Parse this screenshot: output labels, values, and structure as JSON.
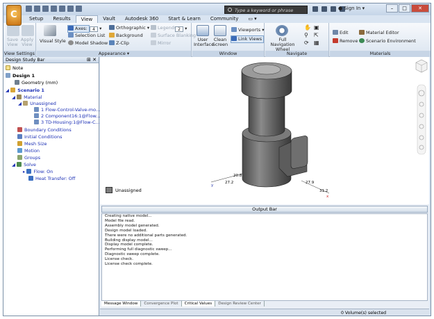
{
  "titlebar": {
    "search_placeholder": "Type a keyword or phrase",
    "signin": "Sign In"
  },
  "tabs": [
    "Setup",
    "Results",
    "View",
    "Vault",
    "Autodesk 360",
    "Start & Learn",
    "Community"
  ],
  "active_tab": "View",
  "ribbon": {
    "view_settings": {
      "save_view": "Save View",
      "apply_view": "Apply View",
      "label": "View Settings"
    },
    "appearance": {
      "visual_style": "Visual Style",
      "axes": "Axes:",
      "axes_value": "4",
      "selection_list": "Selection List",
      "model_shadow": "Model Shadow",
      "orthographic": "Orthographic",
      "background": "Background",
      "z_clip": "Z-Clip",
      "legends": "Legends:",
      "legends_value": "2",
      "surface_blanking": "Surface Blanking",
      "mirror": "Mirror",
      "label": "Appearance"
    },
    "window": {
      "user_interface": "User Interface",
      "clean_screen": "Clean Screen",
      "viewports": "Viewports",
      "link_views": "Link Views",
      "label": "Window"
    },
    "navigate": {
      "full_navigation_wheel": "Full Navigation Wheel",
      "label": "Navigate"
    },
    "materials": {
      "edit": "Edit",
      "remove": "Remove",
      "material_editor": "Material Editor",
      "scenario_environment": "Scenario Environment",
      "label": "Materials"
    }
  },
  "design_study_bar": {
    "title": "Design Study Bar",
    "items": [
      "Note",
      "Design 1",
      "Geometry (mm)",
      "Scenario 1",
      "Material",
      "Unassigned",
      "1 Flow-Control-Valve-mo...",
      "2 Component16:1@Flow...",
      "3 TD-Housing:1@Flow-C...",
      "Boundary Conditions",
      "Initial Conditions",
      "Mesh Size",
      "Motion",
      "Groups",
      "Solve",
      "Flow: On",
      "Heat Transfer: Off"
    ]
  },
  "viewport": {
    "legend": "Unassigned",
    "dims": [
      "20.8",
      "27.2",
      "27.9",
      "31.2"
    ]
  },
  "output_bar": {
    "title": "Output Bar",
    "lines": [
      "Creating native model...",
      "Model file read.",
      "Assembly model generated.",
      "Design model loaded.",
      "There were no additional parts generated.",
      "Building display model...",
      "Display model complete.",
      "Performing full diagnostic sweep...",
      "Diagnostic sweep complete.",
      "License check.",
      "License check complete."
    ],
    "tabs": [
      "Message Window",
      "Convergence Plot",
      "Critical Values",
      "Design Review Center"
    ]
  },
  "status": {
    "text": "0 Volume(s) selected"
  },
  "colors": {
    "ribbon_bg": "#dbe5f0",
    "selection_blue": "#1b2fb5",
    "model_gray": "#6f6f6f"
  }
}
